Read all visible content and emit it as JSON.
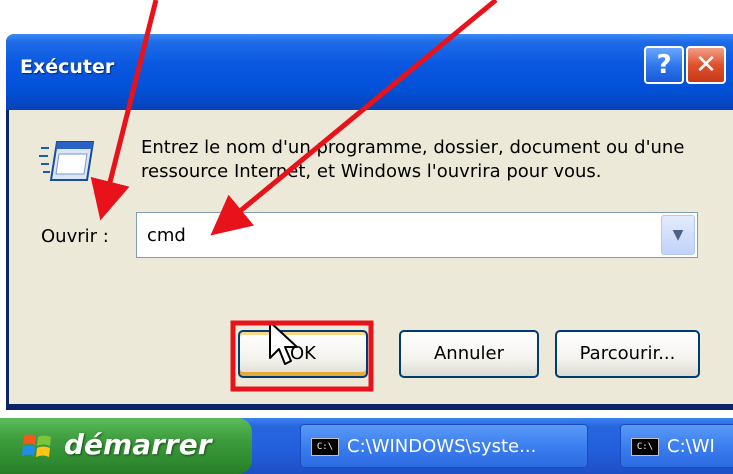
{
  "dialog": {
    "title": "Exécuter",
    "help_symbol": "?",
    "close_symbol": "✕",
    "description_line1": "Entrez le nom d'un programme, dossier, document ou d'une",
    "description_line2": "ressource Internet, et Windows l'ouvrira pour vous.",
    "open_label": "Ouvrir :",
    "open_value": "cmd",
    "dropdown_symbol": "▼",
    "ok_label": "OK",
    "cancel_label": "Annuler",
    "browse_label": "Parcourir..."
  },
  "taskbar": {
    "start_label": "démarrer",
    "buttons": [
      {
        "icon": "console-icon",
        "icon_text": "C:\\",
        "label": "C:\\WINDOWS\\syste..."
      },
      {
        "icon": "console-icon",
        "icon_text": "C:\\",
        "label": "C:\\WI"
      }
    ]
  },
  "colors": {
    "annotation_red": "#e8121a",
    "title_blue": "#0150d6",
    "start_green": "#3c9c3c",
    "dialog_face": "#ece9d8"
  }
}
